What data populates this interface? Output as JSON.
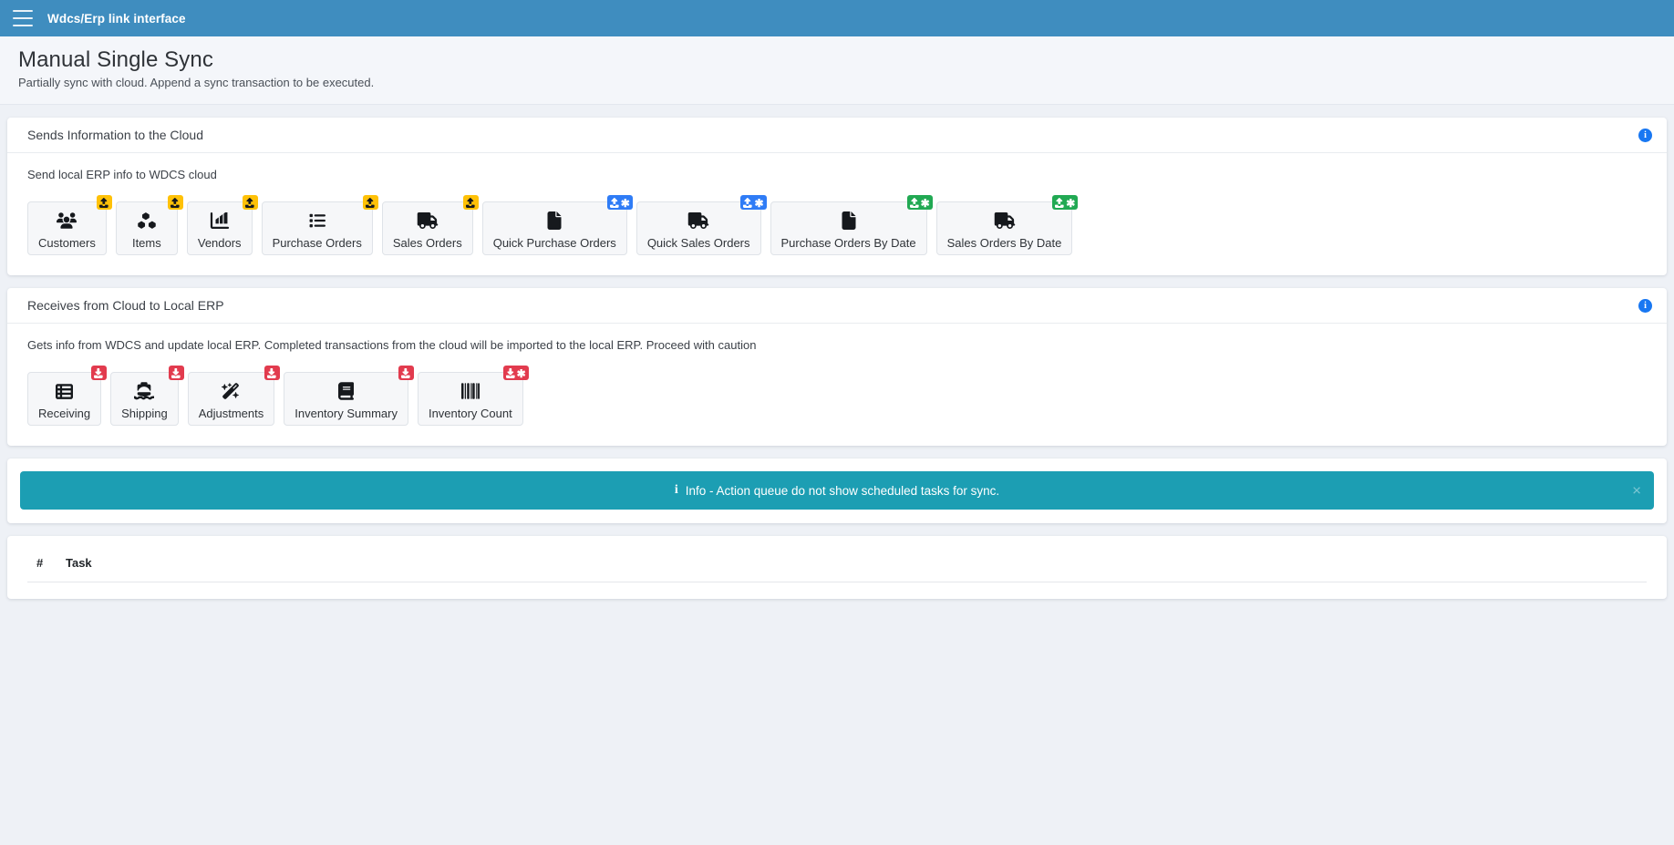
{
  "navbar": {
    "menu_icon": "hamburger-icon",
    "brand": "Wdcs/Erp link interface"
  },
  "page": {
    "title": "Manual Single Sync",
    "subtitle": "Partially sync with cloud. Append a sync transaction to be executed."
  },
  "send_card": {
    "header": "Sends Information to the Cloud",
    "info_icon": "info-icon",
    "info_glyph": "i",
    "description": "Send local ERP info to WDCS cloud",
    "buttons": [
      {
        "label": "Customers",
        "icon": "users-icon",
        "badge_color": "yellow",
        "badge_icon": "upload-icon",
        "badge_star": false
      },
      {
        "label": "Items",
        "icon": "boxes-icon",
        "badge_color": "yellow",
        "badge_icon": "upload-icon",
        "badge_star": false
      },
      {
        "label": "Vendors",
        "icon": "factory-icon",
        "badge_color": "yellow",
        "badge_icon": "upload-icon",
        "badge_star": false
      },
      {
        "label": "Purchase Orders",
        "icon": "list-icon",
        "badge_color": "yellow",
        "badge_icon": "upload-icon",
        "badge_star": false
      },
      {
        "label": "Sales Orders",
        "icon": "truck-icon",
        "badge_color": "yellow",
        "badge_icon": "upload-icon",
        "badge_star": false
      },
      {
        "label": "Quick Purchase Orders",
        "icon": "file-icon",
        "badge_color": "blue",
        "badge_icon": "upload-icon",
        "badge_star": true
      },
      {
        "label": "Quick Sales Orders",
        "icon": "truck-icon",
        "badge_color": "blue",
        "badge_icon": "upload-icon",
        "badge_star": true
      },
      {
        "label": "Purchase Orders By Date",
        "icon": "file-icon",
        "badge_color": "green",
        "badge_icon": "upload-icon",
        "badge_star": true
      },
      {
        "label": "Sales Orders By Date",
        "icon": "truck-icon",
        "badge_color": "green",
        "badge_icon": "upload-icon",
        "badge_star": true
      }
    ]
  },
  "receive_card": {
    "header": "Receives from Cloud to Local ERP",
    "info_icon": "info-icon",
    "info_glyph": "i",
    "description": "Gets info from WDCS and update local ERP. Completed transactions from the cloud will be imported to the local ERP. Proceed with caution",
    "buttons": [
      {
        "label": "Receiving",
        "icon": "table-list-icon",
        "badge_color": "red",
        "badge_icon": "download-icon",
        "badge_star": false
      },
      {
        "label": "Shipping",
        "icon": "ship-icon",
        "badge_color": "red",
        "badge_icon": "download-icon",
        "badge_star": false
      },
      {
        "label": "Adjustments",
        "icon": "wand-icon",
        "badge_color": "red",
        "badge_icon": "download-icon",
        "badge_star": false
      },
      {
        "label": "Inventory Summary",
        "icon": "book-icon",
        "badge_color": "red",
        "badge_icon": "download-icon",
        "badge_star": false
      },
      {
        "label": "Inventory Count",
        "icon": "barcode-icon",
        "badge_color": "red",
        "badge_icon": "download-icon",
        "badge_star": true
      }
    ]
  },
  "alert": {
    "icon": "info-icon",
    "glyph": "i",
    "message": "Info - Action queue do not show scheduled tasks for sync.",
    "close_label": "×",
    "color": "#1c9eb3"
  },
  "task_table": {
    "columns": [
      "#",
      "Task"
    ],
    "rows": []
  },
  "colors": {
    "navbar": "#3f8dbf",
    "page_bg": "#eef1f6",
    "badge_yellow": "#ffc107",
    "badge_blue": "#2f7cf6",
    "badge_green": "#21a953",
    "badge_red": "#e23b4e",
    "info_blue": "#1877f2"
  }
}
